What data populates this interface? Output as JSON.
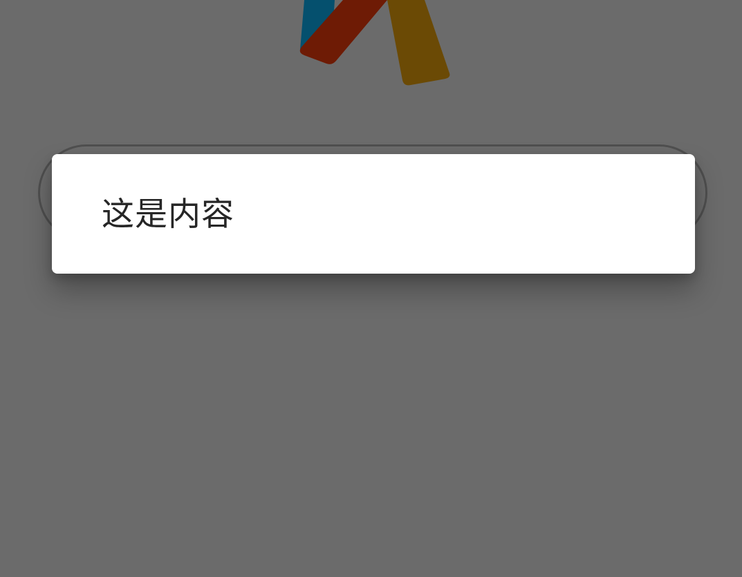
{
  "logo": {
    "icon": "app-logo-icon",
    "colors": {
      "blue": "#05506e",
      "red": "#6e1b05",
      "gold": "#6b4a05"
    }
  },
  "dialog": {
    "content": "这是内容"
  },
  "colors": {
    "overlay": "#6b6b6b",
    "dialog_bg": "#ffffff",
    "text": "#262626"
  }
}
